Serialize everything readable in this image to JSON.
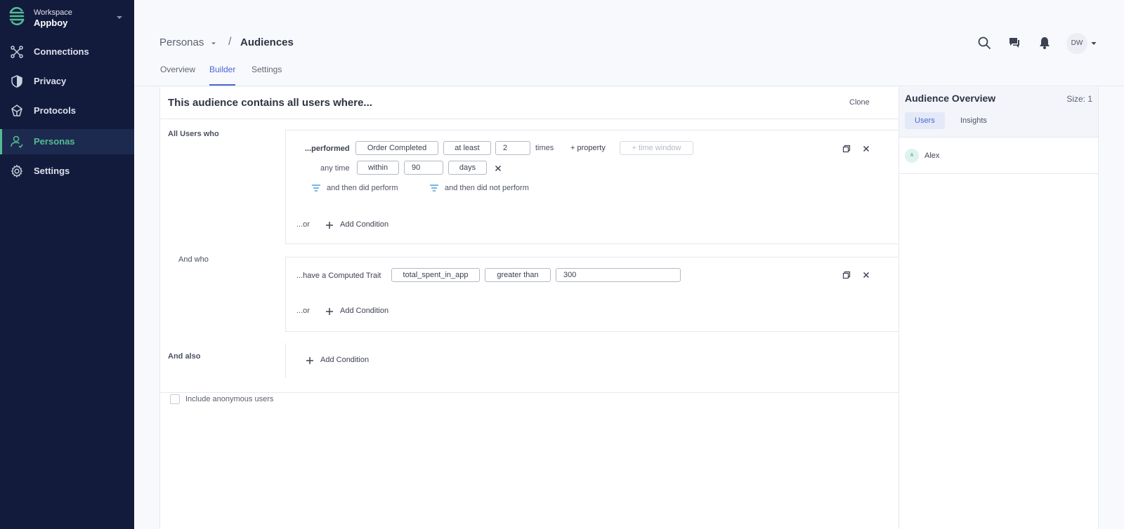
{
  "sidebar": {
    "workspace_label": "Workspace",
    "workspace_name": "Appboy",
    "items": [
      {
        "label": "Connections",
        "icon": "connections-icon"
      },
      {
        "label": "Privacy",
        "icon": "shield-icon"
      },
      {
        "label": "Protocols",
        "icon": "protocols-icon"
      },
      {
        "label": "Personas",
        "icon": "person-icon",
        "active": true
      },
      {
        "label": "Settings",
        "icon": "gear-icon"
      }
    ]
  },
  "header": {
    "breadcrumb": {
      "parent": "Personas",
      "separator": "/",
      "current": "Audiences"
    },
    "tabs": [
      {
        "label": "Overview"
      },
      {
        "label": "Builder",
        "active": true
      },
      {
        "label": "Settings"
      }
    ],
    "avatar_initials": "DW"
  },
  "builder": {
    "title": "This audience contains all users where...",
    "clone_label": "Clone",
    "group1": {
      "label": "All Users who",
      "performed_text": "...performed",
      "event": "Order Completed",
      "operator": "at least",
      "count": "2",
      "times_text": "times",
      "property_link": "+ property",
      "time_window_placeholder": "+ time window",
      "any_time_text": "any time",
      "within": "within",
      "within_value": "90",
      "unit": "days",
      "then_did_perform": "and then did perform",
      "then_did_not_perform": "and then did not perform",
      "or_text": "...or",
      "add_condition": "Add Condition"
    },
    "group2": {
      "label": "And who",
      "trait_text": "...have a Computed Trait",
      "trait": "total_spent_in_app",
      "operator": "greater than",
      "value": "300",
      "or_text": "...or",
      "add_condition": "Add Condition"
    },
    "group3": {
      "label": "And also",
      "add_condition": "Add Condition"
    },
    "include_anonymous": "Include anonymous users"
  },
  "overview": {
    "title": "Audience Overview",
    "size": "Size: 1",
    "tabs": [
      {
        "label": "Users",
        "active": true
      },
      {
        "label": "Insights"
      }
    ],
    "users": [
      {
        "initial": "A",
        "name": "Alex"
      }
    ]
  },
  "colors": {
    "sidebar_bg": "#131b3d",
    "accent_green": "#52bd94",
    "accent_blue": "#4966d6"
  }
}
